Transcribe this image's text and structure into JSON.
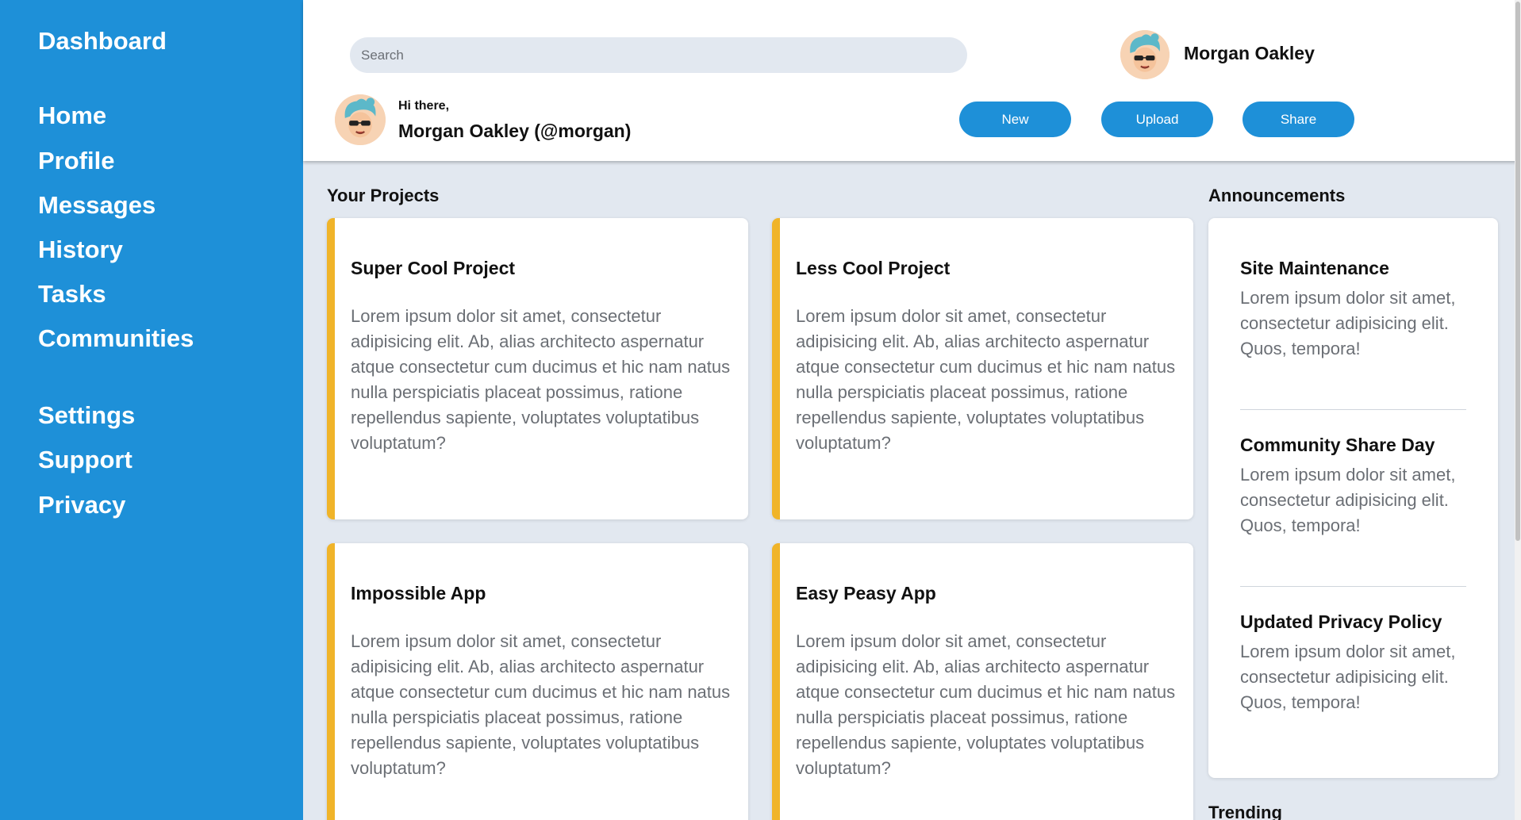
{
  "sidebar": {
    "title": "Dashboard",
    "nav": [
      {
        "label": "Home",
        "icon": "none"
      },
      {
        "label": "Profile"
      },
      {
        "label": "Messages"
      },
      {
        "label": "History"
      },
      {
        "label": "Tasks"
      },
      {
        "label": "Communities"
      }
    ],
    "secondary": [
      {
        "label": "Settings"
      },
      {
        "label": "Support"
      },
      {
        "label": "Privacy"
      }
    ]
  },
  "header": {
    "search_placeholder": "Search",
    "user_name": "Morgan Oakley",
    "greeting": "Hi there,",
    "greeting_name": "Morgan Oakley (@morgan)",
    "buttons": {
      "new": "New",
      "upload": "Upload",
      "share": "Share"
    }
  },
  "projects": {
    "title": "Your Projects",
    "items": [
      {
        "title": "Super Cool Project",
        "body": "Lorem ipsum dolor sit amet, consectetur adipisicing elit. Ab, alias architecto aspernatur atque consectetur cum ducimus et hic nam natus nulla perspiciatis placeat possimus, ratione repellendus sapiente, voluptates voluptatibus voluptatum?"
      },
      {
        "title": "Less Cool Project",
        "body": "Lorem ipsum dolor sit amet, consectetur adipisicing elit. Ab, alias architecto aspernatur atque consectetur cum ducimus et hic nam natus nulla perspiciatis placeat possimus, ratione repellendus sapiente, voluptates voluptatibus voluptatum?"
      },
      {
        "title": "Impossible App",
        "body": "Lorem ipsum dolor sit amet, consectetur adipisicing elit. Ab, alias architecto aspernatur atque consectetur cum ducimus et hic nam natus nulla perspiciatis placeat possimus, ratione repellendus sapiente, voluptates voluptatibus voluptatum?"
      },
      {
        "title": "Easy Peasy App",
        "body": "Lorem ipsum dolor sit amet, consectetur adipisicing elit. Ab, alias architecto aspernatur atque consectetur cum ducimus et hic nam natus nulla perspiciatis placeat possimus, ratione repellendus sapiente, voluptates voluptatibus voluptatum?"
      }
    ]
  },
  "announcements": {
    "title": "Announcements",
    "items": [
      {
        "title": "Site Maintenance",
        "body": "Lorem ipsum dolor sit amet, consectetur adipisicing elit. Quos, tempora!"
      },
      {
        "title": "Community Share Day",
        "body": "Lorem ipsum dolor sit amet, consectetur adipisicing elit. Quos, tempora!"
      },
      {
        "title": "Updated Privacy Policy",
        "body": "Lorem ipsum dolor sit amet, consectetur adipisicing elit. Quos, tempora!"
      }
    ]
  },
  "trending": {
    "title": "Trending"
  },
  "colors": {
    "sidebar": "#1e90d8",
    "accent": "#f0b429",
    "background": "#e2e8f0"
  }
}
